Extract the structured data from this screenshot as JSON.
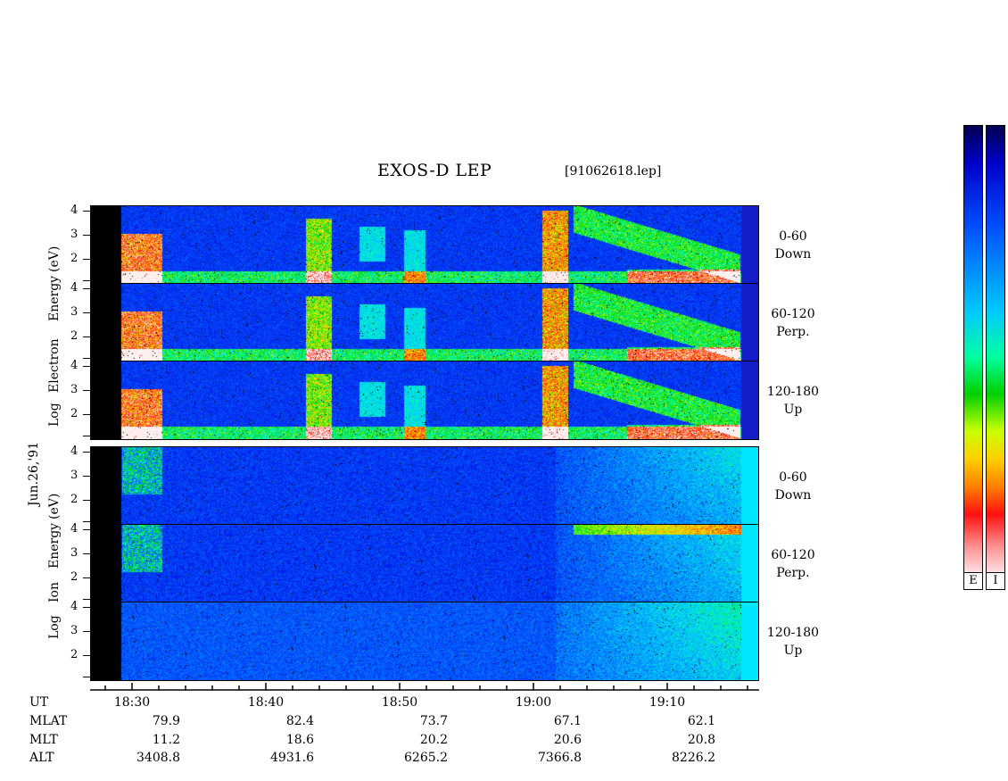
{
  "chart_data": {
    "type": "heatmap",
    "title": "EXOS-D LEP",
    "file_label": "[91062618.lep]",
    "date_label": "Jun.26,'91",
    "groups": [
      {
        "name": "Electron",
        "ylabel_parts": [
          "Log",
          "Electron",
          "Energy",
          "(eV)"
        ],
        "panels": [
          {
            "channel": [
              "0-60",
              "Down"
            ],
            "y_ticks": [
              "4",
              "3",
              "2",
              ""
            ]
          },
          {
            "channel": [
              "60-120",
              "Perp."
            ],
            "y_ticks": [
              "4",
              "3",
              "2",
              ""
            ]
          },
          {
            "channel": [
              "120-180",
              "Up"
            ],
            "y_ticks": [
              "4",
              "3",
              "2",
              ""
            ]
          }
        ]
      },
      {
        "name": "Ion",
        "ylabel_parts": [
          "Log",
          "Ion",
          "Energy",
          "(eV)"
        ],
        "panels": [
          {
            "channel": [
              "0-60",
              "Down"
            ],
            "y_ticks": [
              "4",
              "3",
              "2",
              ""
            ]
          },
          {
            "channel": [
              "60-120",
              "Perp."
            ],
            "y_ticks": [
              "4",
              "3",
              "2",
              ""
            ]
          },
          {
            "channel": [
              "120-180",
              "Up"
            ],
            "y_ticks": [
              "4",
              "3",
              "2",
              ""
            ]
          }
        ]
      }
    ],
    "y_range": [
      1,
      4
    ],
    "x_axis": {
      "row_labels": [
        "UT",
        "MLAT",
        "MLT",
        "ALT"
      ],
      "ticks": [
        {
          "UT": "18:30",
          "MLAT": "79.9",
          "MLT": "11.2",
          "ALT": "3408.8"
        },
        {
          "UT": "18:40",
          "MLAT": "82.4",
          "MLT": "18.6",
          "ALT": "4931.6"
        },
        {
          "UT": "18:50",
          "MLAT": "73.7",
          "MLT": "20.2",
          "ALT": "6265.2"
        },
        {
          "UT": "19:00",
          "MLAT": "67.1",
          "MLT": "20.6",
          "ALT": "7366.8"
        },
        {
          "UT": "19:10",
          "MLAT": "62.1",
          "MLT": "20.8",
          "ALT": "8226.2"
        }
      ]
    },
    "colorbars": [
      "E",
      "I"
    ],
    "colors": {
      "background_panel": "#0a20d0",
      "data_gap": "#000000",
      "low": "#0000c8",
      "mid": "#00ffff",
      "high": "#ff1010",
      "max": "#ffffff"
    }
  }
}
